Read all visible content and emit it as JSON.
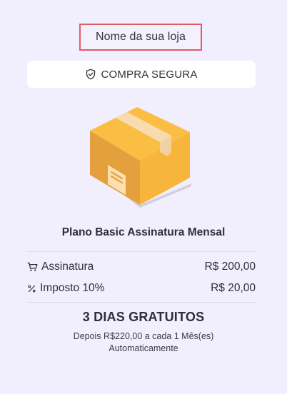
{
  "store": {
    "name": "Nome da sua loja"
  },
  "secure": {
    "label": "COMPRA SEGURA",
    "icon": "shield-check-icon"
  },
  "product": {
    "image_icon": "package-box-icon",
    "title": "Plano Basic Assinatura Mensal"
  },
  "summary": {
    "subscription": {
      "icon": "cart-icon",
      "label": "Assinatura",
      "value": "R$ 200,00"
    },
    "tax": {
      "icon": "percent-icon",
      "label": "Imposto 10%",
      "value": "R$ 20,00"
    }
  },
  "trial": {
    "title": "3 DIAS GRATUITOS",
    "line1": "Depois R$220,00 a cada 1 Mês(es)",
    "line2": "Automaticamente"
  },
  "colors": {
    "background": "#f1effd",
    "highlight_border": "#e25c64",
    "box_main": "#f7b53a",
    "box_dark": "#e5a23a"
  }
}
